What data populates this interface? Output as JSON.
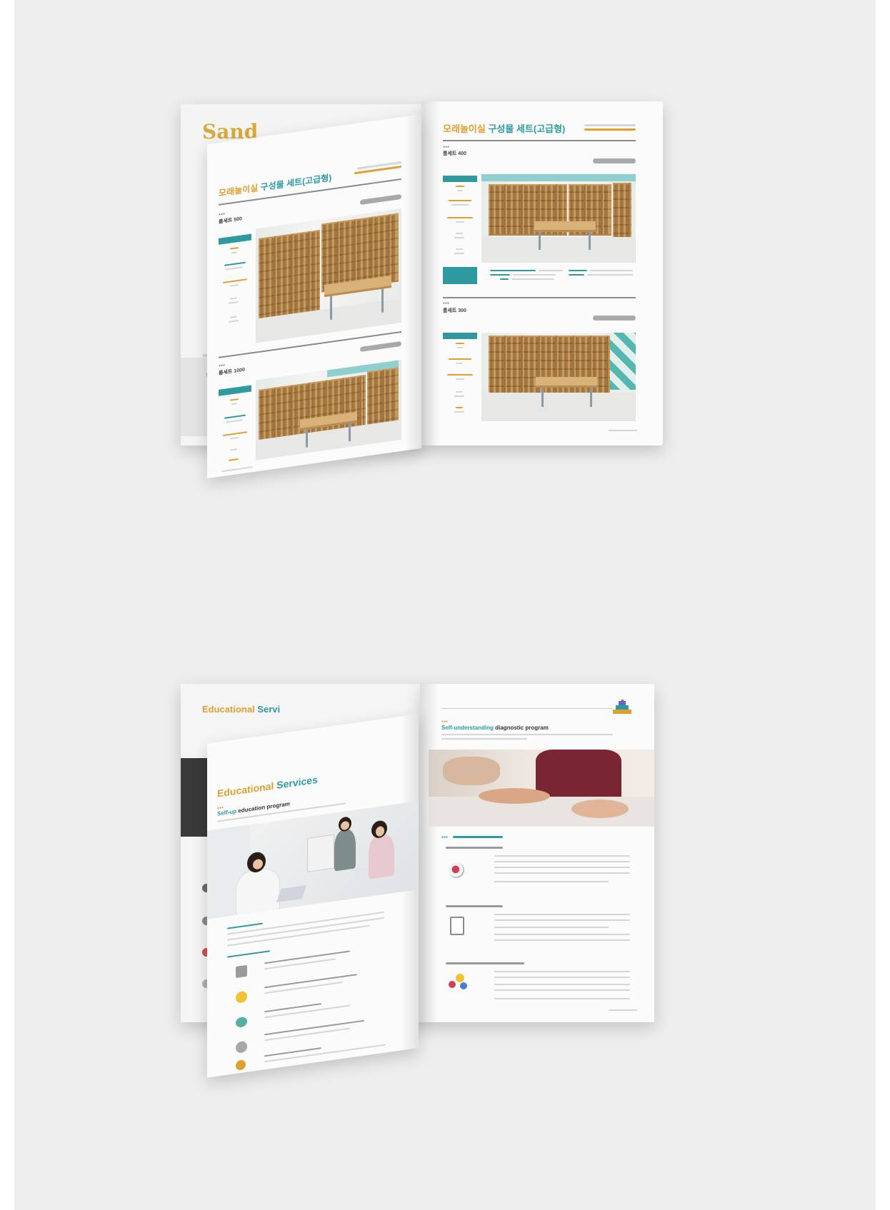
{
  "brochure_top": {
    "back_page": {
      "partial_title": "Sand"
    },
    "left_page": {
      "title_part1": "모래놀이실",
      "title_part2": "구성물 세트(고급형)",
      "sections": [
        {
          "model": "룸세트 500"
        },
        {
          "model": "룸세트 1000"
        }
      ]
    },
    "right_page": {
      "title_part1": "모래놀이실",
      "title_part2": "구성물 세트(고급형)",
      "sections": [
        {
          "model": "룸세트 400"
        },
        {
          "model": "룸세트 300"
        }
      ]
    }
  },
  "brochure_bottom": {
    "back_page": {
      "partial_title_part1": "Educational",
      "partial_title_part2": "Servi"
    },
    "left_page": {
      "title_part1": "Educational",
      "title_part2": "Services",
      "program_title_part1": "Self-up",
      "program_title_part2": "education program"
    },
    "right_page": {
      "program_title_part1": "Self-understanding",
      "program_title_part2": "diagnostic program"
    }
  },
  "colors": {
    "accent_orange": "#e0a030",
    "accent_teal": "#2e9aa0",
    "background": "#eeeeee"
  },
  "icons": [
    "heart-check-icon",
    "document-icon",
    "lightbulb-people-icon",
    "book-icon",
    "bulb-icon",
    "chat-icon",
    "stack-blocks-icon"
  ]
}
